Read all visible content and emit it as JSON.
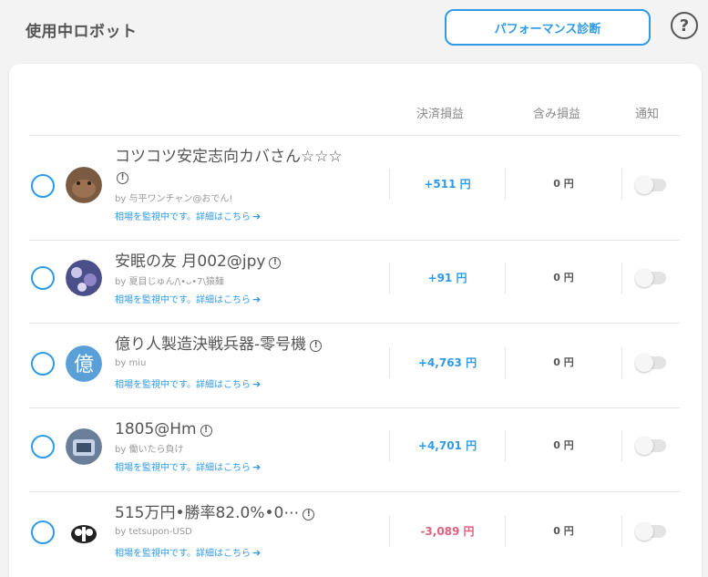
{
  "header": {
    "title": "使用中ロボット",
    "perf_button": "パフォーマンス診断",
    "help": "?"
  },
  "table": {
    "columns": [
      "決済損益",
      "含み損益",
      "通知"
    ],
    "rows": [
      {
        "name": "コツコツ安定志向カバさん☆☆☆",
        "author": "by 与平ワンチャン@おでん!",
        "status": "相場を監視中です。詳細はこちら",
        "settled": "+511 円",
        "unrealized": "0 円",
        "settled_negative": false
      },
      {
        "name": "安眠の友 月002@jpy",
        "author": "by 夏目じゅん/\\•ᴗ•7\\猿麺",
        "status": "相場を監視中です。詳細はこちら",
        "settled": "+91 円",
        "unrealized": "0 円",
        "settled_negative": false
      },
      {
        "name": "億り人製造決戦兵器-零号機",
        "author": "by miu",
        "status": "相場を監視中です。詳細はこちら",
        "settled": "+4,763 円",
        "unrealized": "0 円",
        "settled_negative": false
      },
      {
        "name": "1805@Hm",
        "author": "by 働いたら負け",
        "status": "相場を監視中です。詳細はこちら",
        "settled": "+4,701 円",
        "unrealized": "0 円",
        "settled_negative": false
      },
      {
        "name": "515万円•勝率82.0%•0⋯",
        "author": "by tetsupon-USD",
        "status": "相場を監視中です。詳細はこちら",
        "settled": "-3,089 円",
        "unrealized": "0 円",
        "settled_negative": true
      }
    ]
  },
  "colors": {
    "accent": "#2f9ae6",
    "negative": "#e0607e"
  },
  "icons": {
    "help": "question-circle-icon",
    "info": "info-circle-icon",
    "arrow": "arrow-right-icon"
  }
}
